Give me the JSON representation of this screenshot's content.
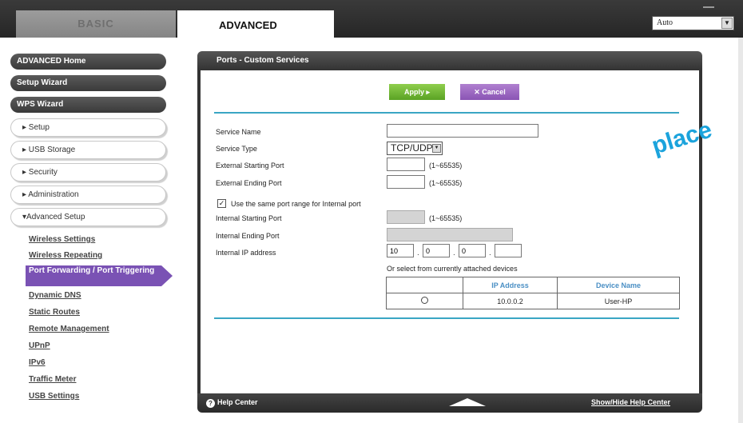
{
  "tabs": {
    "basic": "BASIC",
    "advanced": "ADVANCED"
  },
  "language": {
    "selected": "Auto"
  },
  "sidebar": {
    "main_items": [
      {
        "label": "ADVANCED Home"
      },
      {
        "label": "Setup Wizard"
      },
      {
        "label": "WPS Wizard"
      }
    ],
    "sections": [
      {
        "label": "▸ Setup"
      },
      {
        "label": "▸ USB Storage"
      },
      {
        "label": "▸ Security"
      },
      {
        "label": "▸ Administration"
      },
      {
        "label": "▾Advanced Setup"
      }
    ],
    "sub_items": [
      {
        "label": "Wireless Settings"
      },
      {
        "label": "Wireless Repeating"
      },
      {
        "label": "Port Forwarding / Port Triggering"
      },
      {
        "label": "Dynamic DNS"
      },
      {
        "label": "Static Routes"
      },
      {
        "label": "Remote Management"
      },
      {
        "label": "UPnP"
      },
      {
        "label": "IPv6"
      },
      {
        "label": "Traffic Meter"
      },
      {
        "label": "USB Settings"
      }
    ]
  },
  "panel": {
    "title": "Ports - Custom Services",
    "apply_label": "Apply ▸",
    "cancel_label": "✕ Cancel"
  },
  "form": {
    "service_name": {
      "label": "Service Name",
      "value": ""
    },
    "service_type": {
      "label": "Service Type",
      "value": "TCP/UDP"
    },
    "external_start": {
      "label": "External Starting Port",
      "value": "",
      "hint": "(1~65535)"
    },
    "external_end": {
      "label": "External Ending Port",
      "value": "",
      "hint": "(1~65535)"
    },
    "same_range": {
      "label": "Use the same port range for Internal port",
      "checked": true
    },
    "internal_start": {
      "label": "Internal Starting Port",
      "value": "",
      "hint": "(1~65535)"
    },
    "internal_end": {
      "label": "Internal Ending Port",
      "value": ""
    },
    "internal_ip": {
      "label": "Internal IP address",
      "octets": [
        "10",
        "0",
        "0",
        ""
      ]
    },
    "devices_caption": "Or select from currently attached devices"
  },
  "devices": {
    "headers": [
      "",
      "IP Address",
      "Device Name"
    ],
    "rows": [
      {
        "ip": "10.0.0.2",
        "name": "User-HP"
      }
    ]
  },
  "footer": {
    "help_label": "Help Center",
    "help_toggle": "Show/Hide Help Center"
  },
  "watermark": "place",
  "colors": {
    "accent_blue": "#3aa6c4",
    "apply_green": "#6cb52e",
    "cancel_purple": "#9a66c4",
    "active_item": "#7a52b4"
  }
}
